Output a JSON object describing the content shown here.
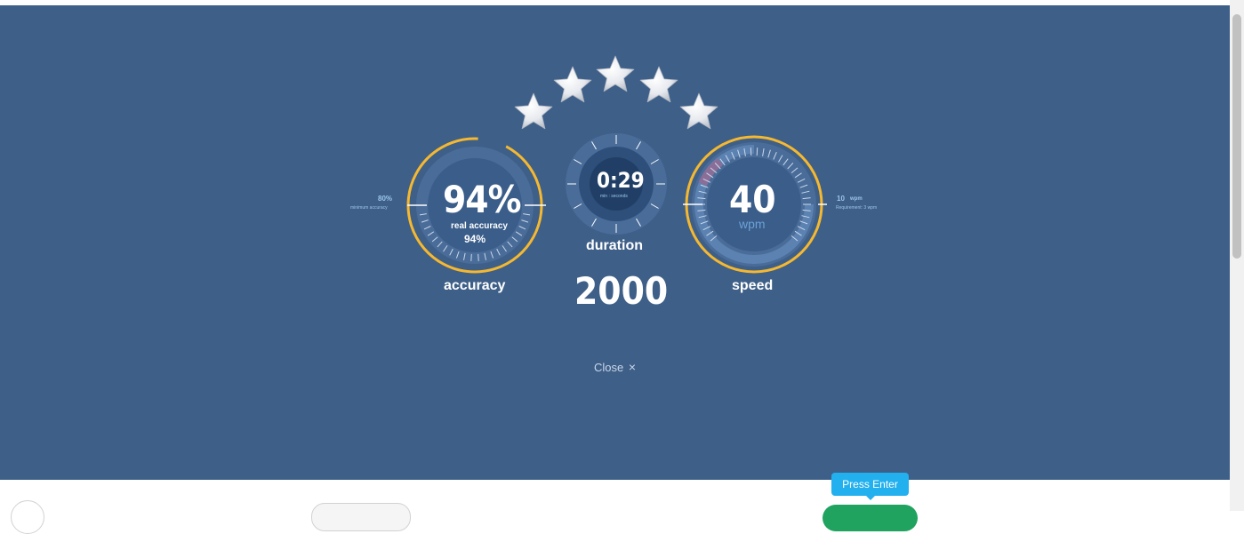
{
  "results": {
    "stars": {
      "rating": 0,
      "max": 5
    },
    "accuracy": {
      "value": "94%",
      "real_label": "real accuracy",
      "real_value": "94%",
      "label": "accuracy",
      "min_value": "80%",
      "min_label": "minimum accuracy",
      "fill_fraction": 0.94
    },
    "duration": {
      "value": "0:29",
      "unit": "min : seconds",
      "label": "duration"
    },
    "score": "2000",
    "speed": {
      "value": "40",
      "unit": "wpm",
      "label": "speed",
      "req_value": "10",
      "req_unit": "wpm",
      "req_label": "Requirement: 3 wpm"
    },
    "close_label": "Close",
    "close_icon": "×"
  },
  "footer": {
    "tooltip": "Press Enter"
  },
  "colors": {
    "panel": "#3e5f88",
    "gauge_ring": "#f5b830",
    "accent_text": "#9cc6ea",
    "tooltip": "#22b0ee",
    "next_button": "#1fa35f"
  }
}
